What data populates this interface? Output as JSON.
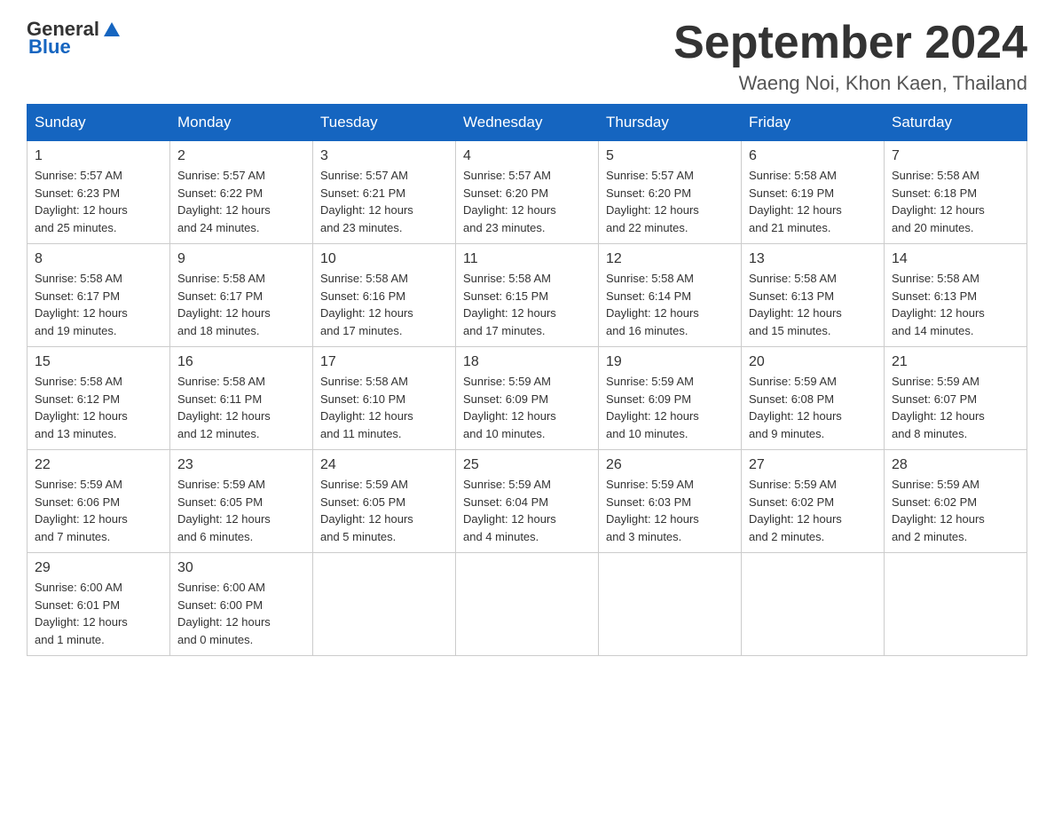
{
  "header": {
    "logo_general": "General",
    "logo_blue": "Blue",
    "title": "September 2024",
    "subtitle": "Waeng Noi, Khon Kaen, Thailand"
  },
  "days_of_week": [
    "Sunday",
    "Monday",
    "Tuesday",
    "Wednesday",
    "Thursday",
    "Friday",
    "Saturday"
  ],
  "weeks": [
    [
      {
        "day": "1",
        "sunrise": "5:57 AM",
        "sunset": "6:23 PM",
        "daylight": "12 hours and 25 minutes."
      },
      {
        "day": "2",
        "sunrise": "5:57 AM",
        "sunset": "6:22 PM",
        "daylight": "12 hours and 24 minutes."
      },
      {
        "day": "3",
        "sunrise": "5:57 AM",
        "sunset": "6:21 PM",
        "daylight": "12 hours and 23 minutes."
      },
      {
        "day": "4",
        "sunrise": "5:57 AM",
        "sunset": "6:20 PM",
        "daylight": "12 hours and 23 minutes."
      },
      {
        "day": "5",
        "sunrise": "5:57 AM",
        "sunset": "6:20 PM",
        "daylight": "12 hours and 22 minutes."
      },
      {
        "day": "6",
        "sunrise": "5:58 AM",
        "sunset": "6:19 PM",
        "daylight": "12 hours and 21 minutes."
      },
      {
        "day": "7",
        "sunrise": "5:58 AM",
        "sunset": "6:18 PM",
        "daylight": "12 hours and 20 minutes."
      }
    ],
    [
      {
        "day": "8",
        "sunrise": "5:58 AM",
        "sunset": "6:17 PM",
        "daylight": "12 hours and 19 minutes."
      },
      {
        "day": "9",
        "sunrise": "5:58 AM",
        "sunset": "6:17 PM",
        "daylight": "12 hours and 18 minutes."
      },
      {
        "day": "10",
        "sunrise": "5:58 AM",
        "sunset": "6:16 PM",
        "daylight": "12 hours and 17 minutes."
      },
      {
        "day": "11",
        "sunrise": "5:58 AM",
        "sunset": "6:15 PM",
        "daylight": "12 hours and 17 minutes."
      },
      {
        "day": "12",
        "sunrise": "5:58 AM",
        "sunset": "6:14 PM",
        "daylight": "12 hours and 16 minutes."
      },
      {
        "day": "13",
        "sunrise": "5:58 AM",
        "sunset": "6:13 PM",
        "daylight": "12 hours and 15 minutes."
      },
      {
        "day": "14",
        "sunrise": "5:58 AM",
        "sunset": "6:13 PM",
        "daylight": "12 hours and 14 minutes."
      }
    ],
    [
      {
        "day": "15",
        "sunrise": "5:58 AM",
        "sunset": "6:12 PM",
        "daylight": "12 hours and 13 minutes."
      },
      {
        "day": "16",
        "sunrise": "5:58 AM",
        "sunset": "6:11 PM",
        "daylight": "12 hours and 12 minutes."
      },
      {
        "day": "17",
        "sunrise": "5:58 AM",
        "sunset": "6:10 PM",
        "daylight": "12 hours and 11 minutes."
      },
      {
        "day": "18",
        "sunrise": "5:59 AM",
        "sunset": "6:09 PM",
        "daylight": "12 hours and 10 minutes."
      },
      {
        "day": "19",
        "sunrise": "5:59 AM",
        "sunset": "6:09 PM",
        "daylight": "12 hours and 10 minutes."
      },
      {
        "day": "20",
        "sunrise": "5:59 AM",
        "sunset": "6:08 PM",
        "daylight": "12 hours and 9 minutes."
      },
      {
        "day": "21",
        "sunrise": "5:59 AM",
        "sunset": "6:07 PM",
        "daylight": "12 hours and 8 minutes."
      }
    ],
    [
      {
        "day": "22",
        "sunrise": "5:59 AM",
        "sunset": "6:06 PM",
        "daylight": "12 hours and 7 minutes."
      },
      {
        "day": "23",
        "sunrise": "5:59 AM",
        "sunset": "6:05 PM",
        "daylight": "12 hours and 6 minutes."
      },
      {
        "day": "24",
        "sunrise": "5:59 AM",
        "sunset": "6:05 PM",
        "daylight": "12 hours and 5 minutes."
      },
      {
        "day": "25",
        "sunrise": "5:59 AM",
        "sunset": "6:04 PM",
        "daylight": "12 hours and 4 minutes."
      },
      {
        "day": "26",
        "sunrise": "5:59 AM",
        "sunset": "6:03 PM",
        "daylight": "12 hours and 3 minutes."
      },
      {
        "day": "27",
        "sunrise": "5:59 AM",
        "sunset": "6:02 PM",
        "daylight": "12 hours and 2 minutes."
      },
      {
        "day": "28",
        "sunrise": "5:59 AM",
        "sunset": "6:02 PM",
        "daylight": "12 hours and 2 minutes."
      }
    ],
    [
      {
        "day": "29",
        "sunrise": "6:00 AM",
        "sunset": "6:01 PM",
        "daylight": "12 hours and 1 minute."
      },
      {
        "day": "30",
        "sunrise": "6:00 AM",
        "sunset": "6:00 PM",
        "daylight": "12 hours and 0 minutes."
      },
      null,
      null,
      null,
      null,
      null
    ]
  ]
}
